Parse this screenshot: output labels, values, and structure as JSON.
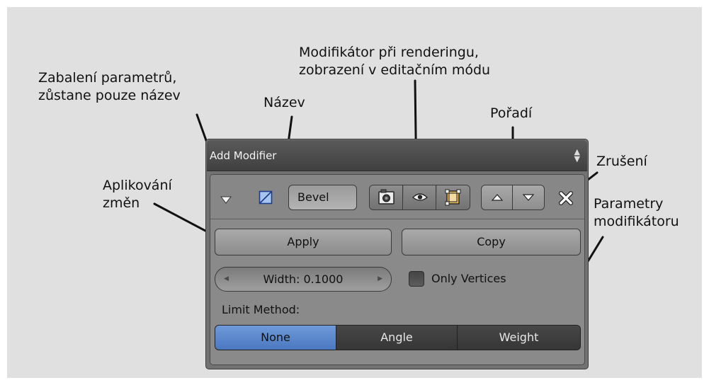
{
  "annotations": {
    "collapse": [
      "Zabalení parametrů,",
      "zůstane pouze název"
    ],
    "name": "Název",
    "render_edit": [
      "Modifikátor při renderingu,",
      "zobrazení v editačním módu"
    ],
    "order": "Pořadí",
    "cancel": "Zrušení",
    "apply": [
      "Aplikování",
      "změn"
    ],
    "parameters": [
      "Parametry",
      "modifikátoru"
    ]
  },
  "panel": {
    "add_modifier_label": "Add Modifier",
    "modifier_name": "Bevel",
    "apply_label": "Apply",
    "copy_label": "Copy",
    "width_field": "Width: 0.1000",
    "only_vertices_label": "Only Vertices",
    "only_vertices_checked": false,
    "limit_method_label": "Limit Method:",
    "limit_methods": [
      "None",
      "Angle",
      "Weight"
    ],
    "selected_limit_method": "None",
    "icons": {
      "collapse": "triangle-down-icon",
      "modifier_type": "bevel-modifier-icon",
      "render": "camera-icon",
      "display": "eye-icon",
      "editmode": "editmode-icon",
      "move_up": "arrow-up-icon",
      "move_down": "arrow-down-icon",
      "remove": "close-icon"
    },
    "colors": {
      "selected": "#5a86c8",
      "dark_segment": "#3c3c3c",
      "panel": "#727272",
      "annotation_bg": "#e0e0e0"
    }
  }
}
